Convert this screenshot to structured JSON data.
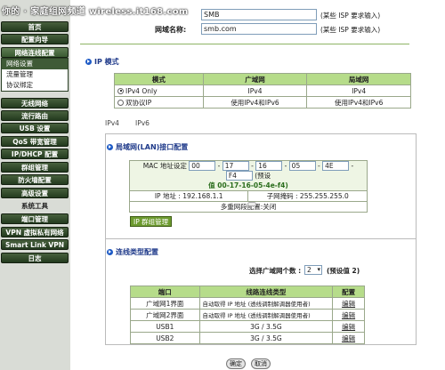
{
  "watermark": "你的 · 家庭组网频道 wireless.it168.com",
  "sidebar": {
    "items": [
      {
        "label": "首页"
      },
      {
        "label": "配置向导"
      },
      {
        "label": "网络连线配置"
      },
      {
        "label": "无线网络"
      },
      {
        "label": "流行路由"
      },
      {
        "label": "USB 设置"
      },
      {
        "label": "QoS 带宽管理"
      },
      {
        "label": "IP/DHCP 配置"
      },
      {
        "label": "群组管理"
      },
      {
        "label": "防火墙配置"
      },
      {
        "label": "高级设置"
      },
      {
        "label": "系统工具"
      },
      {
        "label": "端口管理"
      },
      {
        "label": "VPN 虚拟私有网络"
      },
      {
        "label": "Smart Link VPN"
      },
      {
        "label": "日志"
      }
    ],
    "subitems": [
      {
        "label": "网络设置"
      },
      {
        "label": "流量管理"
      },
      {
        "label": "协议绑定"
      }
    ]
  },
  "top_form": {
    "row1_value": "SMB",
    "row1_hint": "(某些 ISP 要求输入)",
    "domain_label": "网域名称:",
    "domain_value": "smb.com",
    "domain_hint": "(某些 ISP 要求输入)"
  },
  "ip_mode": {
    "heading": "IP 模式",
    "headers": [
      "模式",
      "广域网",
      "局域网"
    ],
    "rows": [
      {
        "mode": "IPv4 Only",
        "wan": "IPv4",
        "lan": "IPv4",
        "selected": true
      },
      {
        "mode": "双协议IP",
        "wan": "使用IPv4和IPv6",
        "lan": "使用IPv4和IPv6",
        "selected": false
      }
    ]
  },
  "tabs": [
    "IPv4",
    "IPv6"
  ],
  "lan": {
    "heading": "局域网(LAN)接口配置",
    "mac_label": "MAC 地址设定",
    "mac_parts": [
      "00",
      "17",
      "16",
      "05",
      "4E",
      "F4"
    ],
    "mac_default_pre": "(预设",
    "mac_default": "值 00-17-16-05-4e-f4)",
    "ip_label": "IP 地址 :",
    "ip_value": "192.168.1.1",
    "mask_label": "子网掩码 :",
    "mask_value": "255.255.255.0",
    "multi_subnet": "多重网段配置:关闭",
    "mgmt_button": "IP 群组管理"
  },
  "conn": {
    "heading": "连线类型配置",
    "wan_count_label": "选择广域网个数 :",
    "wan_count_value": "2",
    "wan_count_default": "(预设值 2)",
    "headers": [
      "端口",
      "线路连线类型",
      "配置"
    ],
    "rows": [
      {
        "port": "广域网1界面",
        "type": "自动取得 IP 地址 (透线调制解调器使用者)",
        "action": "编辑"
      },
      {
        "port": "广域网2界面",
        "type": "自动取得 IP 地址 (透线调制解调器使用者)",
        "action": "编辑"
      },
      {
        "port": "USB1",
        "type": "3G / 3.5G",
        "action": "编辑"
      },
      {
        "port": "USB2",
        "type": "3G / 3.5G",
        "action": "编辑"
      }
    ]
  },
  "buttons": {
    "apply": "确定",
    "cancel": "取消"
  },
  "colors": {
    "nav_bg": "#2e4628",
    "header_green": "#b6dc8a",
    "accent_blue": "#1e5bc6"
  }
}
